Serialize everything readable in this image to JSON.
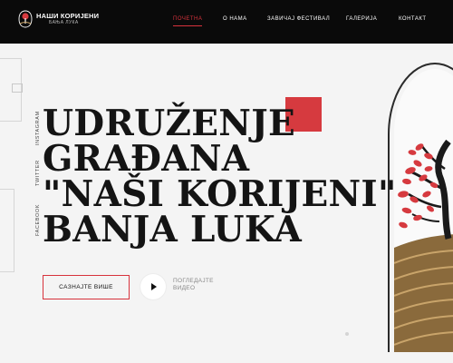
{
  "brand": {
    "name": "НАШИ КОРИЈЕНИ",
    "subtitle": "БАЊА ЛУКА"
  },
  "nav": {
    "items": [
      {
        "label": "ПОЧЕТНА",
        "active": true
      },
      {
        "label": "О НАМА"
      },
      {
        "label": "ЗАВИЧАЈ ФЕСТИВАЛ"
      },
      {
        "label": "ГАЛЕРИЈА"
      },
      {
        "label": "КОНТАКТ"
      }
    ]
  },
  "social": {
    "instagram": "INSTAGRAM",
    "twitter": "TWITTER",
    "facebook": "FACEBOOK"
  },
  "hero": {
    "title_lines": [
      "UDRUŽENJE",
      "GRAĐANA",
      "\"NAŠI KORIJENI\"",
      "BANJA LUKA"
    ],
    "cta_label": "САЗНАЈТЕ ВИШЕ",
    "video_line1": "ПОГЛЕДАЈТЕ",
    "video_line2": "ВИДЕО"
  },
  "colors": {
    "accent": "#d63a3f",
    "nav_bg": "#0a0a0a",
    "page_bg": "#f4f4f4",
    "field": "#8a6a3c"
  },
  "icons": {
    "logo": "tree-logo-icon",
    "play": "play-icon"
  }
}
